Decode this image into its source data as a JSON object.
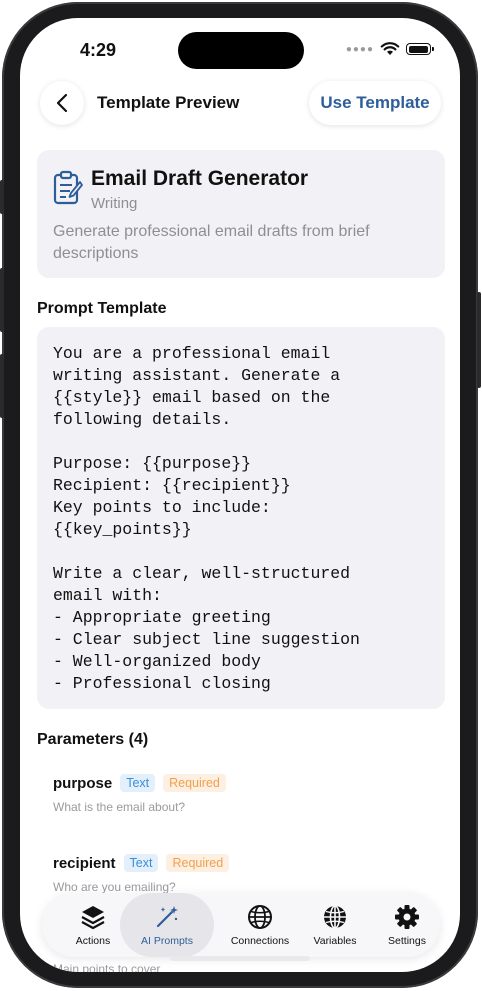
{
  "status_bar": {
    "time": "4:29"
  },
  "nav": {
    "title": "Template Preview",
    "use_template": "Use Template"
  },
  "template": {
    "name": "Email Draft Generator",
    "category": "Writing",
    "description": "Generate professional email drafts from brief descriptions"
  },
  "prompt_section": {
    "title": "Prompt Template",
    "text": "You are a professional email\nwriting assistant. Generate a\n{{style}} email based on the\nfollowing details.\n\nPurpose: {{purpose}}\nRecipient: {{recipient}}\nKey points to include:\n{{key_points}}\n\nWrite a clear, well-structured\nemail with:\n- Appropriate greeting\n- Clear subject line suggestion\n- Well-organized body\n- Professional closing"
  },
  "parameters_section": {
    "title": "Parameters (4)",
    "items": [
      {
        "name": "purpose",
        "type": "Text",
        "required": "Required",
        "description": "What is the email about?"
      },
      {
        "name": "recipient",
        "type": "Text",
        "required": "Required",
        "description": "Who are you emailing?"
      },
      {
        "description": "Main points to cover"
      }
    ]
  },
  "tabbar": {
    "tabs": [
      {
        "label": "Actions",
        "icon": "layers-icon"
      },
      {
        "label": "AI Prompts",
        "icon": "magic-wand-icon"
      },
      {
        "label": "Connections",
        "icon": "globe-icon"
      },
      {
        "label": "Variables",
        "icon": "globe-grid-icon"
      },
      {
        "label": "Settings",
        "icon": "gear-icon"
      }
    ],
    "active_index": 1
  },
  "colors": {
    "accent": "#2e5e9a",
    "tag_text": "#3a8fd6",
    "tag_required": "#f0a04b",
    "card_bg": "#f2f2f6"
  }
}
